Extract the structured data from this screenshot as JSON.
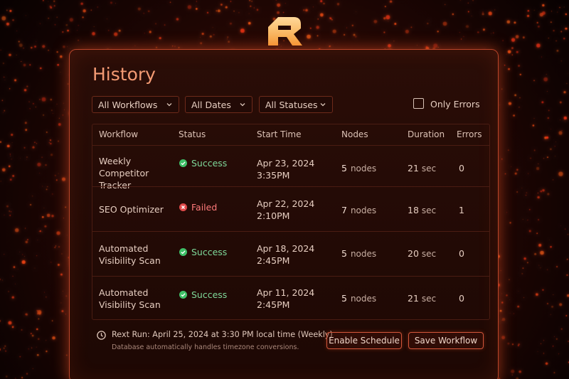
{
  "app": {
    "logo_icon": "r-logo-icon",
    "accent": "#f39a73",
    "border": "#b8452a"
  },
  "page": {
    "title": "History"
  },
  "filters": {
    "workflows": "All Workflows",
    "dates": "All Dates",
    "statuses": "All Statuses",
    "only_errors_label": "Only Errors",
    "only_errors_checked": false
  },
  "table": {
    "columns": [
      "Workflow",
      "Status",
      "Start Time",
      "Nodes",
      "Duration",
      "Errors"
    ],
    "rows": [
      {
        "workflow": "Weekly Competitor Tracker",
        "status": "Success",
        "status_icon": "check-circle-icon",
        "date": "Apr 23, 2024",
        "time": "3:35PM",
        "nodes": "5",
        "nodes_unit": "nodes",
        "duration": "21",
        "duration_unit": "sec",
        "errors": "0"
      },
      {
        "workflow": "SEO Optimizer",
        "status": "Failed",
        "status_icon": "x-circle-icon",
        "date": "Apr 22, 2024",
        "time": "2:10PM",
        "nodes": "7",
        "nodes_unit": "nodes",
        "duration": "18",
        "duration_unit": "sec",
        "errors": "1"
      },
      {
        "workflow": "Automated Visibility Scan",
        "status": "Success",
        "status_icon": "check-circle-icon",
        "date": "Apr 18, 2024",
        "time": "2:45PM",
        "nodes": "5",
        "nodes_unit": "nodes",
        "duration": "20",
        "duration_unit": "sec",
        "errors": "0"
      },
      {
        "workflow": "Automated Visibility Scan",
        "status": "Success",
        "status_icon": "check-circle-icon",
        "date": "Apr 11, 2024",
        "time": "2:45PM",
        "nodes": "5",
        "nodes_unit": "nodes",
        "duration": "21",
        "duration_unit": "sec",
        "errors": "0"
      }
    ]
  },
  "footer": {
    "next_run": "Rext Run: April 25, 2024 at 3:30 PM local time (Weekly)",
    "note": "Database automatically handles timezone conversions."
  },
  "actions": {
    "enable_schedule": "Enable Schedule",
    "save_workflow": "Save Workflow"
  }
}
